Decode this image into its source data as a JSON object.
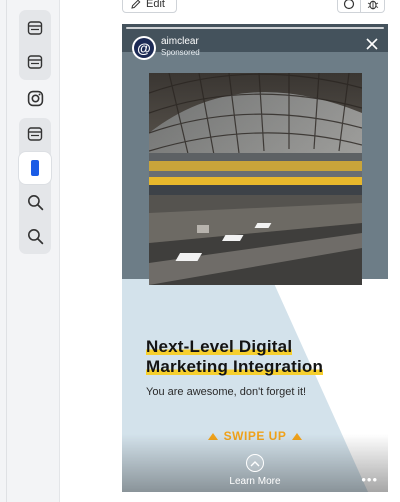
{
  "toolbar": {
    "edit_label": "Edit",
    "icons": [
      "pencil-icon",
      "circle-icon",
      "bug-icon"
    ]
  },
  "rail": {
    "items": [
      {
        "icon": "browser-window-icon"
      },
      {
        "icon": "browser-window-icon"
      },
      {
        "icon": "instagram-icon"
      },
      {
        "icon": "browser-window-icon"
      },
      {
        "icon": "phone-icon",
        "active": true
      },
      {
        "icon": "search-icon"
      },
      {
        "icon": "search-icon"
      }
    ]
  },
  "story": {
    "brand": "aimclear",
    "sponsored": "Sponsored",
    "avatar_glyph": "@",
    "headline_line1": "Next-Level Digital",
    "headline_line2": "Marketing Integration",
    "subtext": "You are awesome, don't forget it!",
    "cta_text": "SWIPE UP",
    "learn_more": "Learn More",
    "more_glyph": "•••",
    "colors": {
      "background": "#d2e1ea",
      "headline_highlight": "#f6cf2d",
      "cta": "#f0a21a",
      "avatar": "#1c2a55"
    },
    "image": "train-station-motion-blur"
  }
}
